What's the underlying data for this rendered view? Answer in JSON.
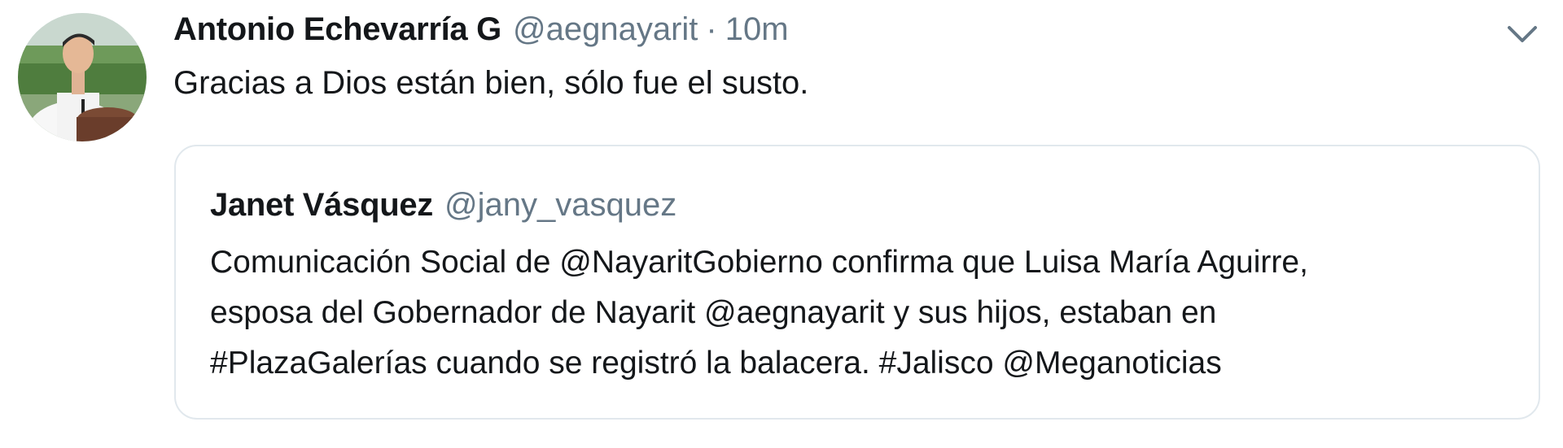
{
  "tweet": {
    "author": {
      "display_name": "Antonio Echevarría G",
      "handle": "@aegnayarit",
      "separator": "·",
      "time": "10m",
      "avatar": "avatar-photo"
    },
    "text": "Gracias a Dios están bien, sólo fue el susto.",
    "menu_icon": "chevron-down-icon",
    "quoted_tweet": {
      "display_name": "Janet Vásquez",
      "handle": "@jany_vasquez",
      "text_lines": [
        "Comunicación Social de @NayaritGobierno confirma que Luisa María Aguirre,",
        "esposa del Gobernador de Nayarit @aegnayarit y sus hijos, estaban en",
        "#PlazaGalerías cuando se registró la balacera. #Jalisco @Meganoticias"
      ]
    }
  },
  "colors": {
    "text_primary": "#14171a",
    "text_secondary": "#657786",
    "border": "#e1e8ed",
    "background": "#ffffff"
  }
}
